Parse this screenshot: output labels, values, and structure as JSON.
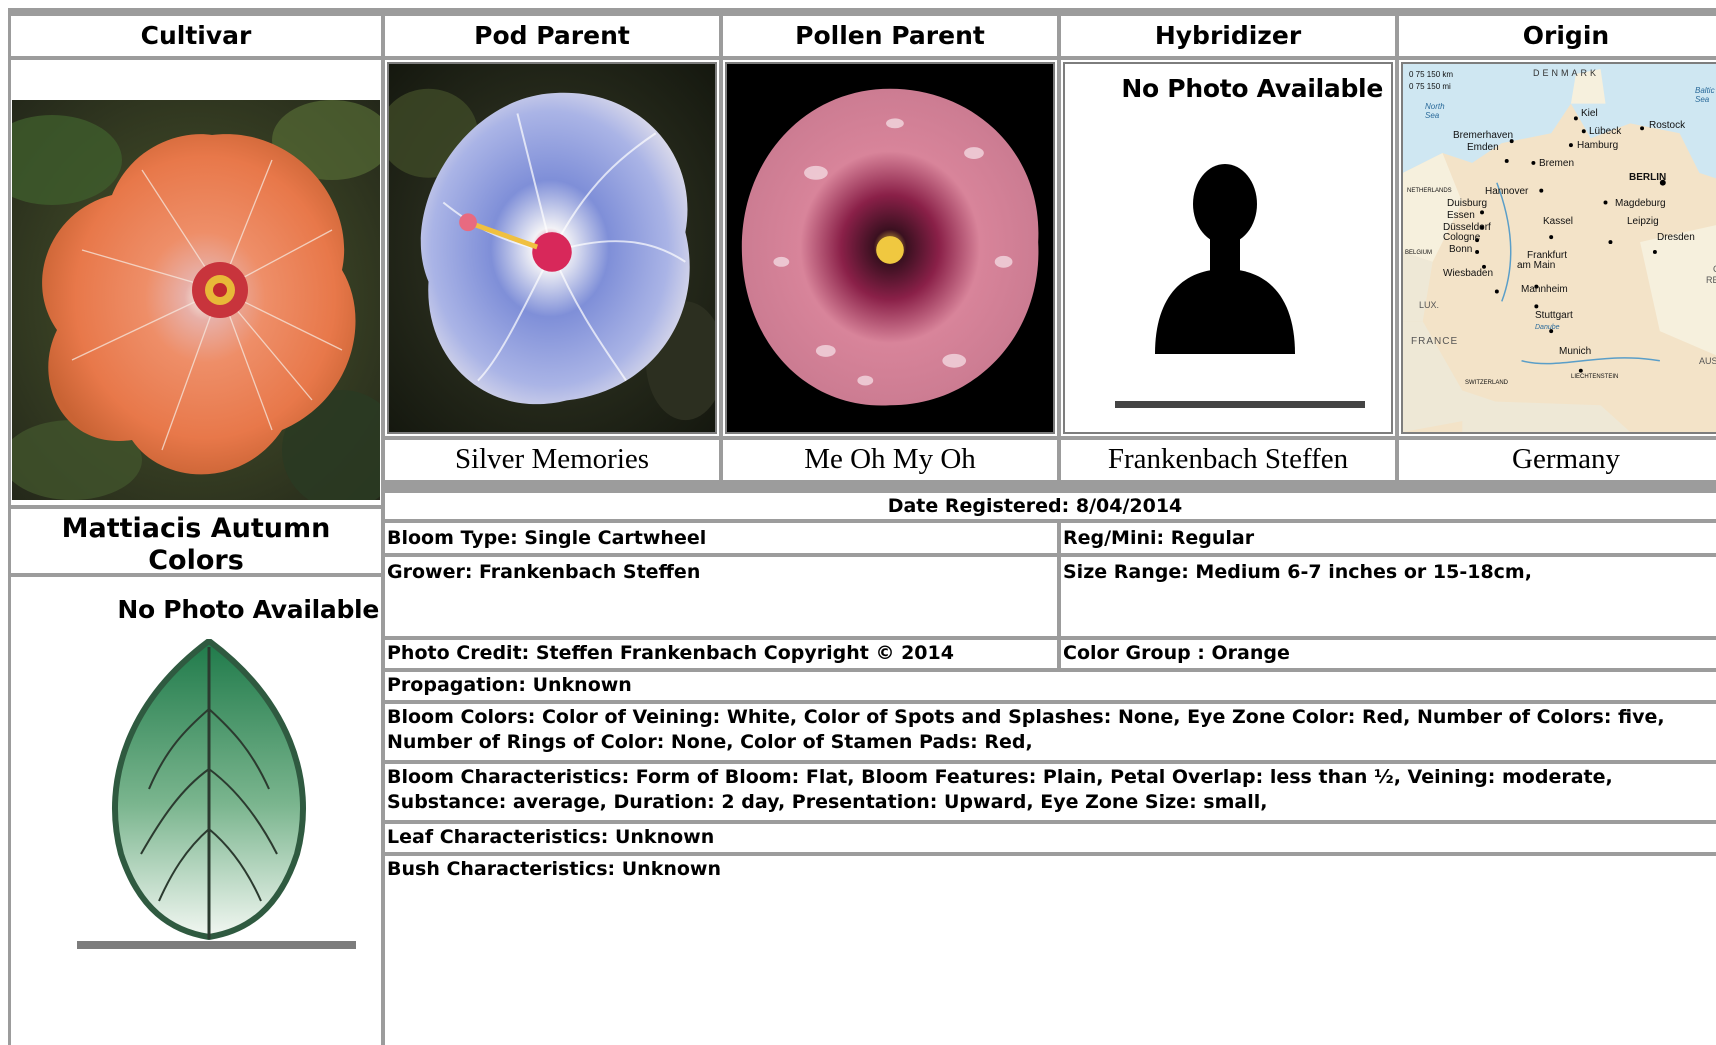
{
  "headers": {
    "cultivar": "Cultivar",
    "pod_parent": "Pod Parent",
    "pollen_parent": "Pollen Parent",
    "hybridizer": "Hybridizer",
    "origin": "Origin"
  },
  "captions": {
    "pod_parent": "Silver Memories",
    "pollen_parent": "Me Oh My Oh",
    "hybridizer": "Frankenbach Steffen",
    "origin": "Germany"
  },
  "cultivar_name": "Mattiacis Autumn Colors",
  "no_photo_text": "No Photo Available",
  "date_registered": "Date Registered:  8/04/2014",
  "details": {
    "bloom_type": "Bloom Type: Single Cartwheel",
    "reg_mini": "Reg/Mini: Regular",
    "grower": "Grower: Frankenbach Steffen",
    "size_range": "Size Range: Medium 6-7 inches or 15-18cm,",
    "photo_credit": "Photo Credit: Steffen Frankenbach Copyright © 2014",
    "color_group": "Color Group : Orange",
    "propagation": "Propagation: Unknown",
    "bloom_colors": "Bloom Colors: Color of Veining: White, Color of Spots and Splashes: None, Eye Zone Color: Red, Number of Colors: five, Number of Rings of Color: None, Color of Stamen Pads: Red,",
    "bloom_characteristics": "Bloom Characteristics: Form of Bloom: Flat, Bloom Features: Plain, Petal Overlap: less than ½, Veining: moderate, Substance: average, Duration: 2 day, Presentation: Upward, Eye Zone Size: small,",
    "leaf_characteristics": "Leaf Characteristics: Unknown",
    "bush_characteristics": "Bush Characteristics: Unknown"
  },
  "map_labels": {
    "kiel": "Kiel",
    "rostock": "Rostock",
    "lubeck": "Lübeck",
    "hamburg": "Hamburg",
    "bremerhaven": "Bremerhaven",
    "emden": "Emden",
    "bremen": "Bremen",
    "berlin": "BERLIN",
    "hannover": "Hannover",
    "magdeburg": "Magdeburg",
    "duisburg": "Duisburg",
    "essen": "Essen",
    "dusseldorf": "Düsseldorf",
    "kassel": "Kassel",
    "leipzig": "Leipzig",
    "cologne": "Cologne",
    "dresden": "Dresden",
    "bonn": "Bonn",
    "frankfurt": "Frankfurt",
    "am_main": "am Main",
    "wiesbaden": "Wiesbaden",
    "mannheim": "Mannheim",
    "stuttgart": "Stuttgart",
    "munich": "Munich",
    "lux": "LUX.",
    "france": "FRANCE",
    "belgium": "BELGIUM",
    "netherlands": "NETHERLANDS",
    "switzerland": "SWITZERLAND",
    "liechtenstein": "LIECHTENSTEIN",
    "north_sea": "North Sea",
    "baltic_sea": "Baltic Sea",
    "denmark": "DENMARK",
    "czech": "CZE REPU",
    "aus": "AUS",
    "danube": "Danube",
    "scale_km": "0   75  150 km",
    "scale_mi": "0     75     150 mi"
  },
  "colors": {
    "grid_border": "#9c9c9c",
    "photo_frame": "#7d7d7d"
  }
}
